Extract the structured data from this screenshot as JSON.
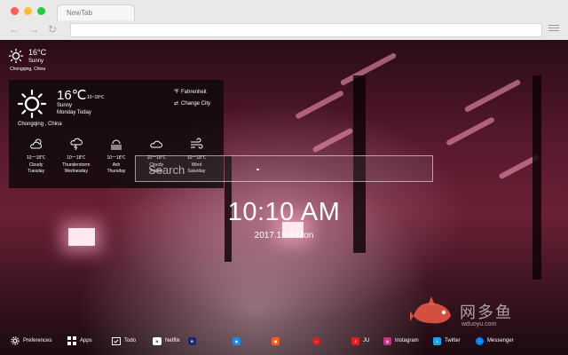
{
  "browser": {
    "tab_title": "NewTab"
  },
  "mini_weather": {
    "temp": "16°C",
    "condition": "Sunny",
    "location": "Chongqing, China",
    "icon": "sun-icon"
  },
  "weather_panel": {
    "temp": "16℃",
    "range": "10~18℃",
    "condition": "Sunny",
    "day": "Monday Today",
    "location": "Chongqing , China",
    "fahrenheit_label": "Fahrenheit",
    "change_city_label": "Change City",
    "fahrenheit_glyph": "℉",
    "change_city_glyph": "⇄",
    "forecast": [
      {
        "range": "10一18℃",
        "condition": "Cloudy",
        "day": "Tuesday",
        "icon": "partly-cloudy-icon"
      },
      {
        "range": "10一18℃",
        "condition": "Thunderstorm",
        "day": "Wednesday",
        "icon": "thunderstorm-icon"
      },
      {
        "range": "10一18℃",
        "condition": "Ash",
        "day": "Thursday",
        "icon": "haze-icon"
      },
      {
        "range": "10一18℃",
        "condition": "Cloudy",
        "day": "Friday",
        "icon": "cloud-icon"
      },
      {
        "range": "10一18℃",
        "condition": "Wind",
        "day": "Saturday",
        "icon": "wind-icon"
      }
    ]
  },
  "search": {
    "placeholder": "Search"
  },
  "clock": {
    "time": "10:10 AM",
    "date": "2017.10.9 Mon"
  },
  "watermark": {
    "text": "网多鱼",
    "url": "wduoyu.com"
  },
  "bottom_bar": {
    "preferences": "Preferences",
    "apps": "Apps",
    "todo": "Todo",
    "netflix": "Netflix",
    "instagram": "Instagram",
    "twitter": "Twitter",
    "messenger": "Messenger",
    "item_ju": "JU"
  },
  "colors": {
    "instagram": "#c13584",
    "twitter": "#1da1f2",
    "messenger": "#0084ff",
    "accent_red": "#e02020",
    "accent_orange": "#ff5a1f"
  }
}
